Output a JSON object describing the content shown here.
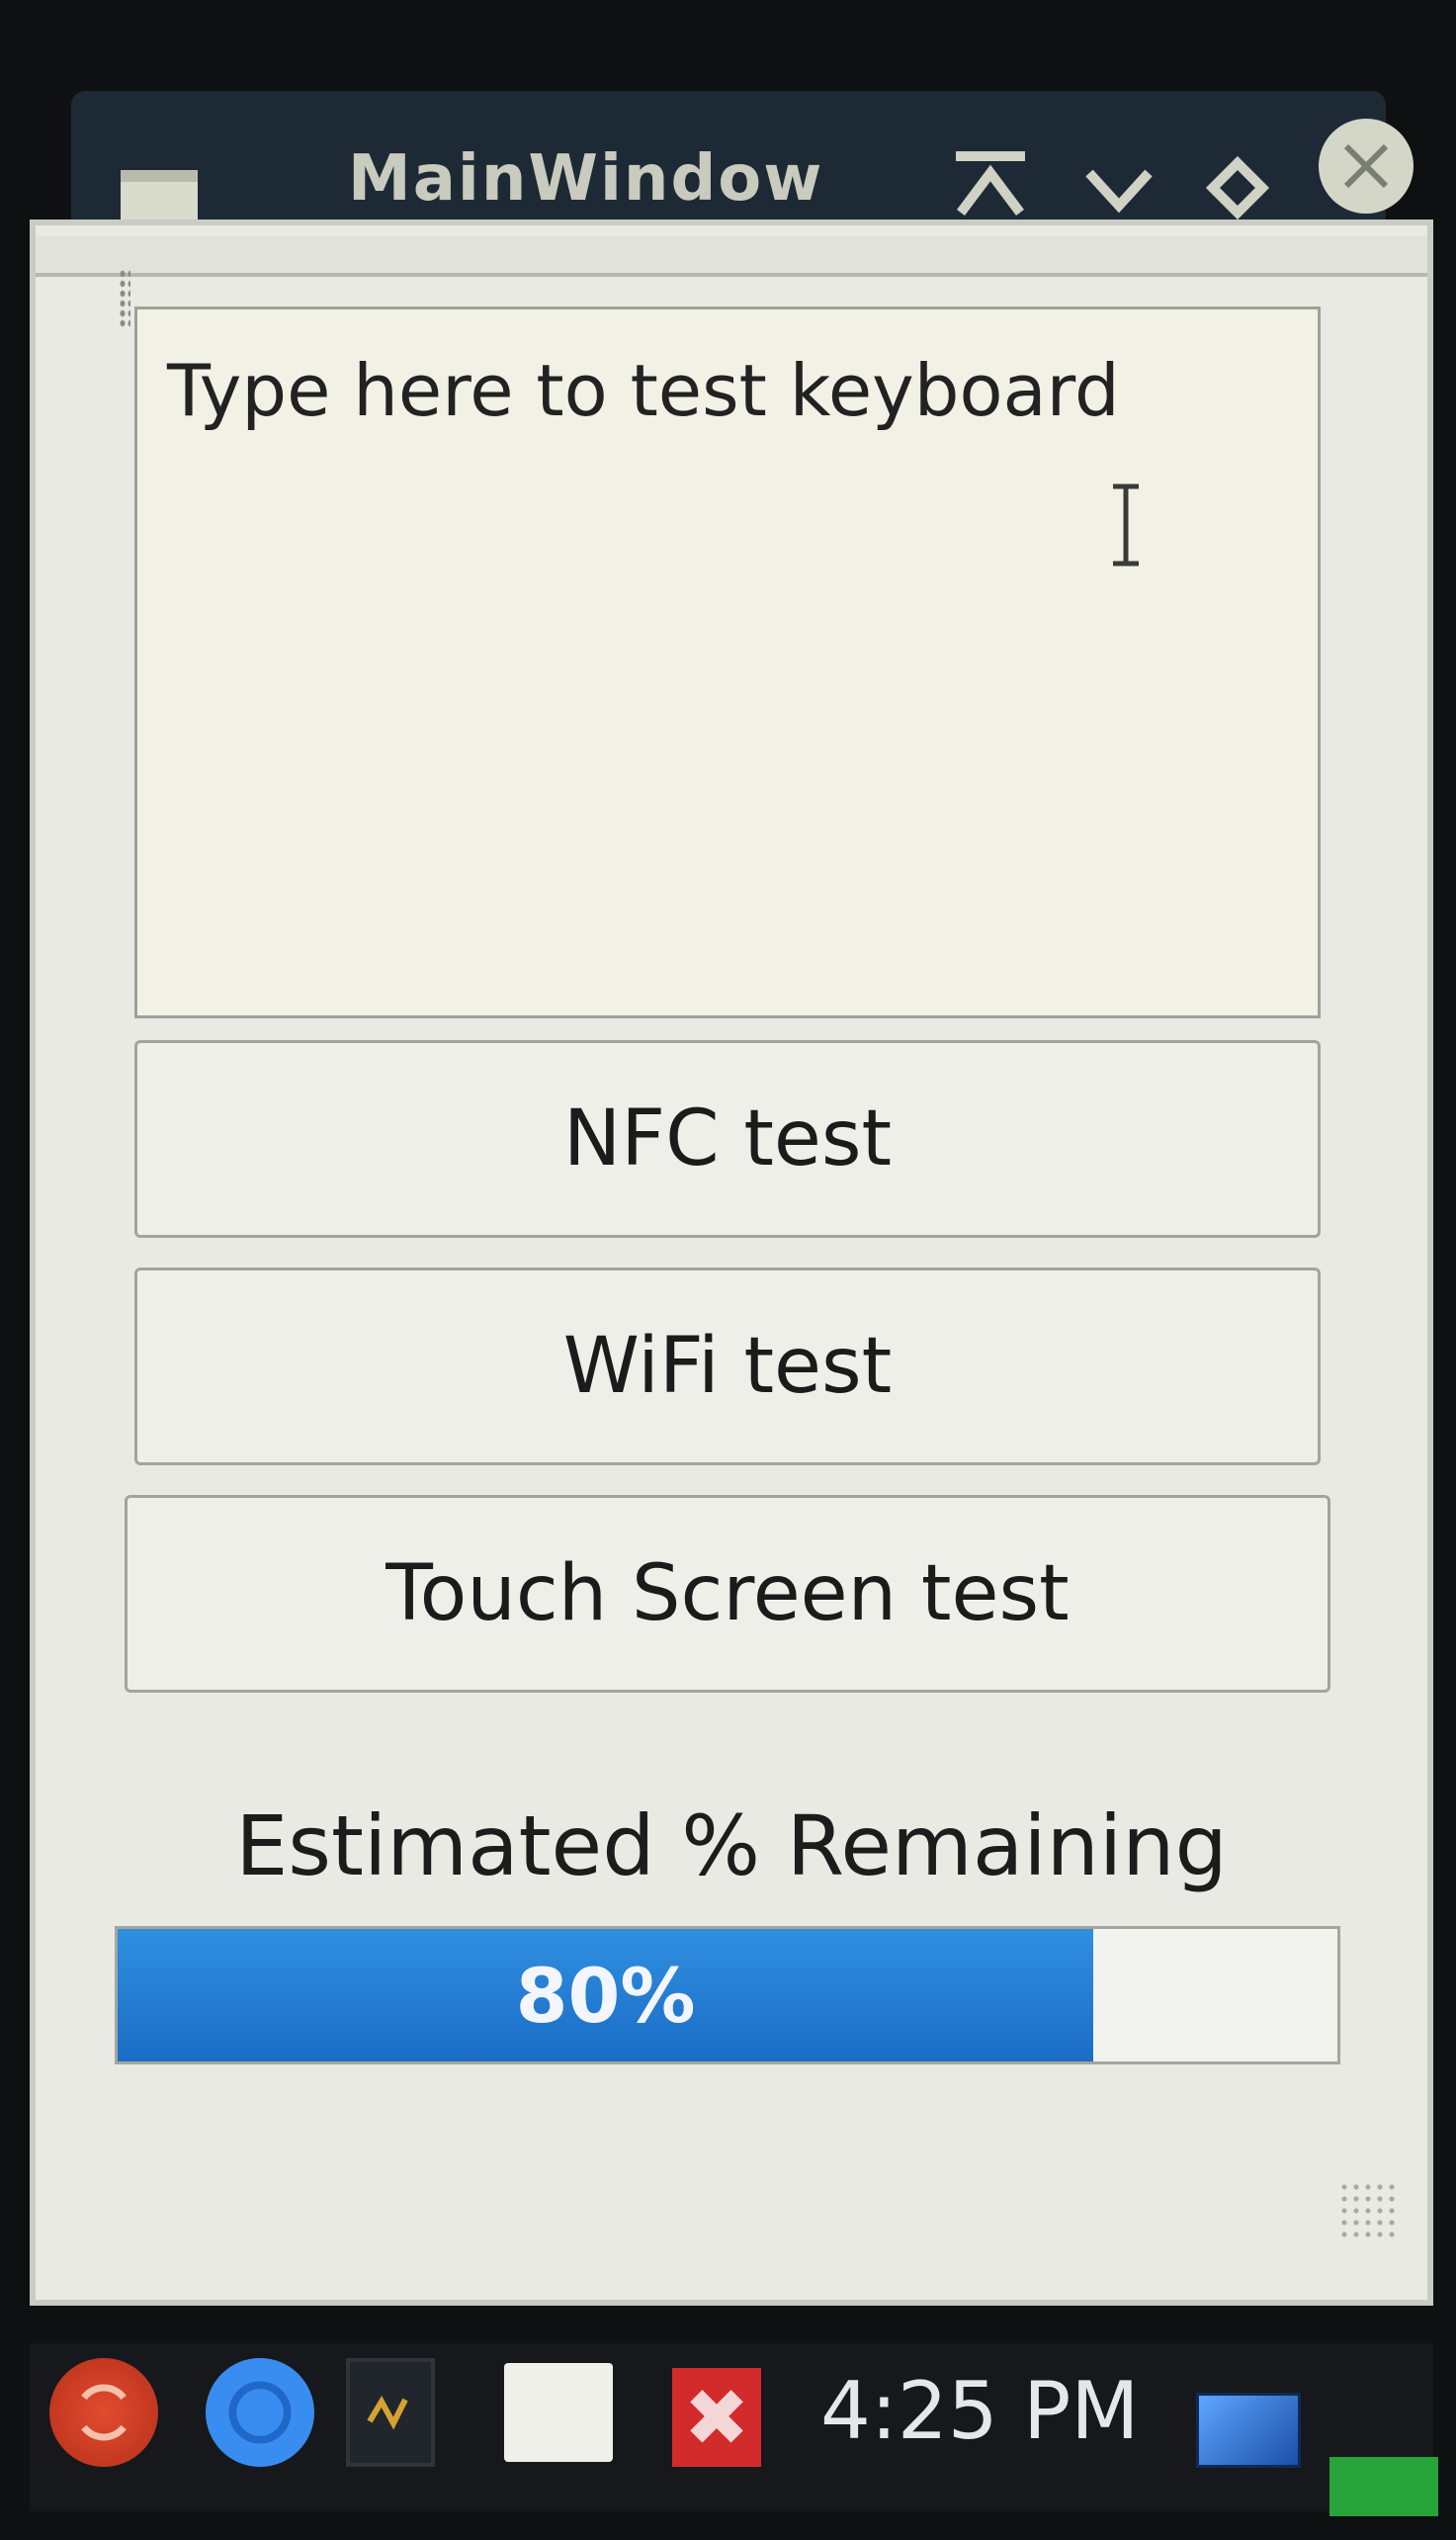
{
  "window": {
    "title": "MainWindow",
    "controls": {
      "shade": "shade-icon",
      "minimize": "chevron-down-icon",
      "maximize": "diamond-icon",
      "close": "close-icon"
    }
  },
  "keyboard_test": {
    "placeholder": "Type here to test keyboard",
    "value": ""
  },
  "buttons": {
    "nfc": "NFC test",
    "wifi": "WiFi test",
    "touch": "Touch Screen test"
  },
  "battery": {
    "label": "Estimated % Remaining",
    "percent": 80,
    "percent_text": "80%",
    "fill_color": "#1b74d3"
  },
  "taskbar": {
    "clock": "4:25 PM",
    "launchers": [
      "menu-icon",
      "browser-icon",
      "terminal-icon",
      "file-manager-icon",
      "close-app-icon",
      "display-icon"
    ]
  }
}
